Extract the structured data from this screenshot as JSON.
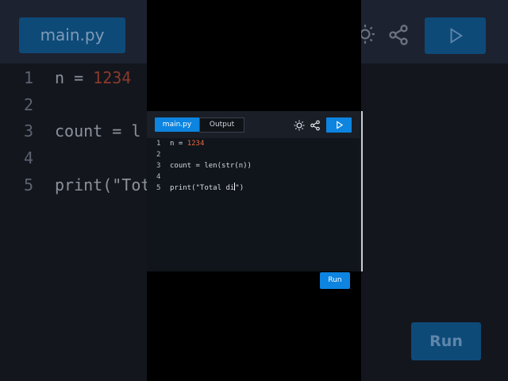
{
  "background": {
    "tab_label": "main.py",
    "run_label": "Run",
    "lines": [
      {
        "num": "1",
        "pre": "n = ",
        "val": "1234",
        "post": ""
      },
      {
        "num": "2",
        "pre": "",
        "val": "",
        "post": ""
      },
      {
        "num": "3",
        "pre": "count = l",
        "val": "",
        "post": ""
      },
      {
        "num": "4",
        "pre": "",
        "val": "",
        "post": ""
      },
      {
        "num": "5",
        "pre": "print(\"Tot",
        "val": "",
        "post": ""
      }
    ]
  },
  "editor": {
    "tabs": {
      "main": "main.py",
      "output": "Output"
    },
    "run_label": "Run",
    "icons": {
      "theme": "sun-icon",
      "share": "share-icon",
      "play": "play-icon"
    },
    "lines": [
      {
        "num": "1",
        "pre": "n = ",
        "val": "1234",
        "post": ""
      },
      {
        "num": "2",
        "pre": "",
        "val": "",
        "post": ""
      },
      {
        "num": "3",
        "pre": "count = len(str(n))",
        "val": "",
        "post": ""
      },
      {
        "num": "4",
        "pre": "",
        "val": "",
        "post": ""
      },
      {
        "num": "5",
        "pre": "print(\"Total di",
        "val": "",
        "post": "\")"
      }
    ],
    "colors": {
      "accent": "#0d84e0",
      "number": "#e8683f"
    }
  }
}
